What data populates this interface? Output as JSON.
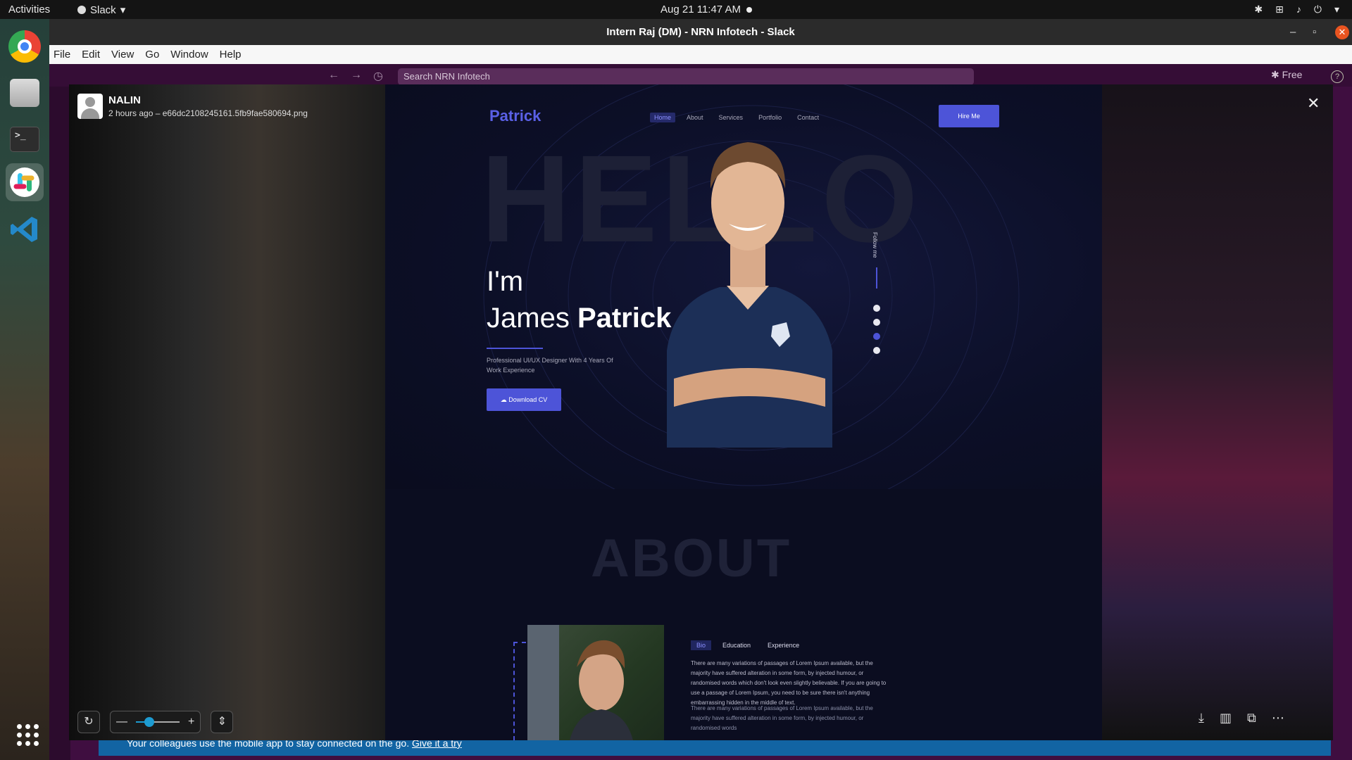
{
  "topbar": {
    "activities": "Activities",
    "app_name": "Slack",
    "datetime": "Aug 21  11:47 AM"
  },
  "window": {
    "title": "Intern Raj (DM) - NRN Infotech - Slack"
  },
  "menu": {
    "items": [
      "File",
      "Edit",
      "View",
      "Go",
      "Window",
      "Help"
    ]
  },
  "slack": {
    "search_placeholder": "Search NRN Infotech",
    "free_label": "Free",
    "banner_text": "Your colleagues use the mobile app to stay connected on the go.",
    "banner_link": "Give it a try"
  },
  "viewer": {
    "sender": "NALIN",
    "meta": "2 hours ago – e66dc2108245161.5fb9fae580694.png",
    "zoom_level": 0.3
  },
  "site": {
    "logo": "Patrick",
    "nav": [
      "Home",
      "About",
      "Services",
      "Portfolio",
      "Contact"
    ],
    "hire_button": "Hire Me",
    "hello": "HELLO",
    "im": "I'm",
    "first_name": "James",
    "last_name": "Patrick",
    "subtitle": "Professional UI/UX Designer With 4 Years Of Work Experience",
    "download_button": "Download CV",
    "follow": "Follow me",
    "about": "ABOUT",
    "tabs": [
      "Bio",
      "Education",
      "Experience"
    ],
    "bio": "There are many variations of passages of Lorem Ipsum available, but the majority have suffered alteration in some form, by injected humour, or randomised words which don't look even slightly believable. If you are going to use a passage of Lorem Ipsum, you need to be sure there isn't anything embarrassing hidden in the middle of text.",
    "bio2": "There are many variations of passages of Lorem Ipsum available, but the majority have suffered alteration in some form, by injected humour, or randomised words"
  },
  "colors": {
    "accent": "#4d54d8",
    "slack_aubergine": "#3f0e40",
    "ubuntu_orange": "#e95420"
  }
}
